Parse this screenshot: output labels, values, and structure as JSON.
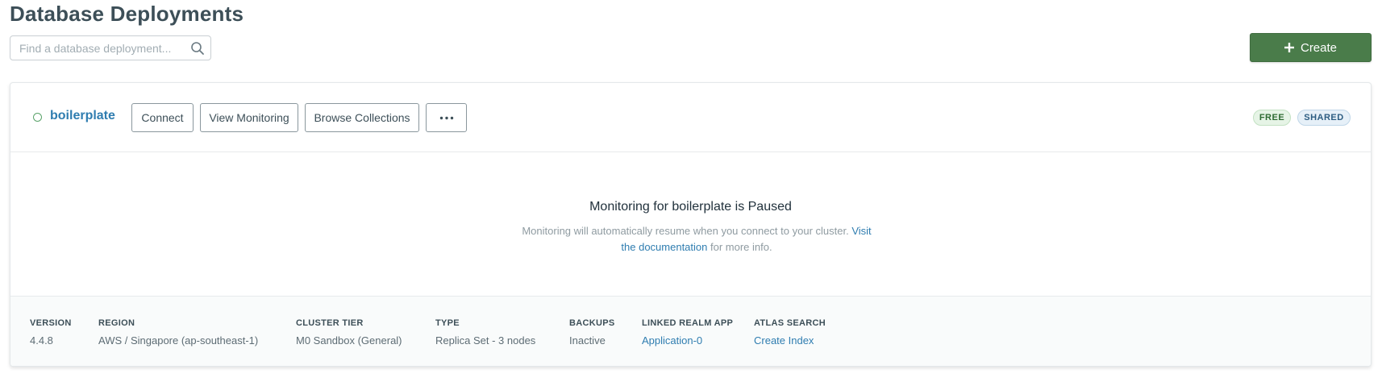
{
  "page": {
    "title": "Database Deployments"
  },
  "search": {
    "placeholder": "Find a database deployment...",
    "value": ""
  },
  "toolbar": {
    "create_label": "Create",
    "create_color": "#4a7c4a"
  },
  "cluster": {
    "name": "boilerplate",
    "status_color": "#5aa36a",
    "actions": {
      "connect": "Connect",
      "view_monitoring": "View Monitoring",
      "browse_collections": "Browse Collections",
      "more": "···"
    },
    "badges": {
      "free": "FREE",
      "shared": "SHARED"
    },
    "monitoring": {
      "title": "Monitoring for boilerplate is Paused",
      "description_before": "Monitoring will automatically resume when you connect to your cluster. ",
      "link_text": "Visit the documentation",
      "description_after": " for more info."
    },
    "details": {
      "version": {
        "label": "VERSION",
        "value": "4.4.8"
      },
      "region": {
        "label": "REGION",
        "value": "AWS / Singapore (ap-southeast-1)"
      },
      "cluster_tier": {
        "label": "CLUSTER TIER",
        "value": "M0 Sandbox (General)"
      },
      "type": {
        "label": "TYPE",
        "value": "Replica Set - 3 nodes"
      },
      "backups": {
        "label": "BACKUPS",
        "value": "Inactive"
      },
      "linked_realm_app": {
        "label": "LINKED REALM APP",
        "value": "Application-0"
      },
      "atlas_search": {
        "label": "ATLAS SEARCH",
        "value": "Create Index"
      }
    }
  },
  "colors": {
    "link": "#2f7db0",
    "text": "#3d4f58"
  },
  "icons": {
    "search": "search-icon",
    "create": "plus-icon",
    "more": "ellipsis-icon"
  }
}
